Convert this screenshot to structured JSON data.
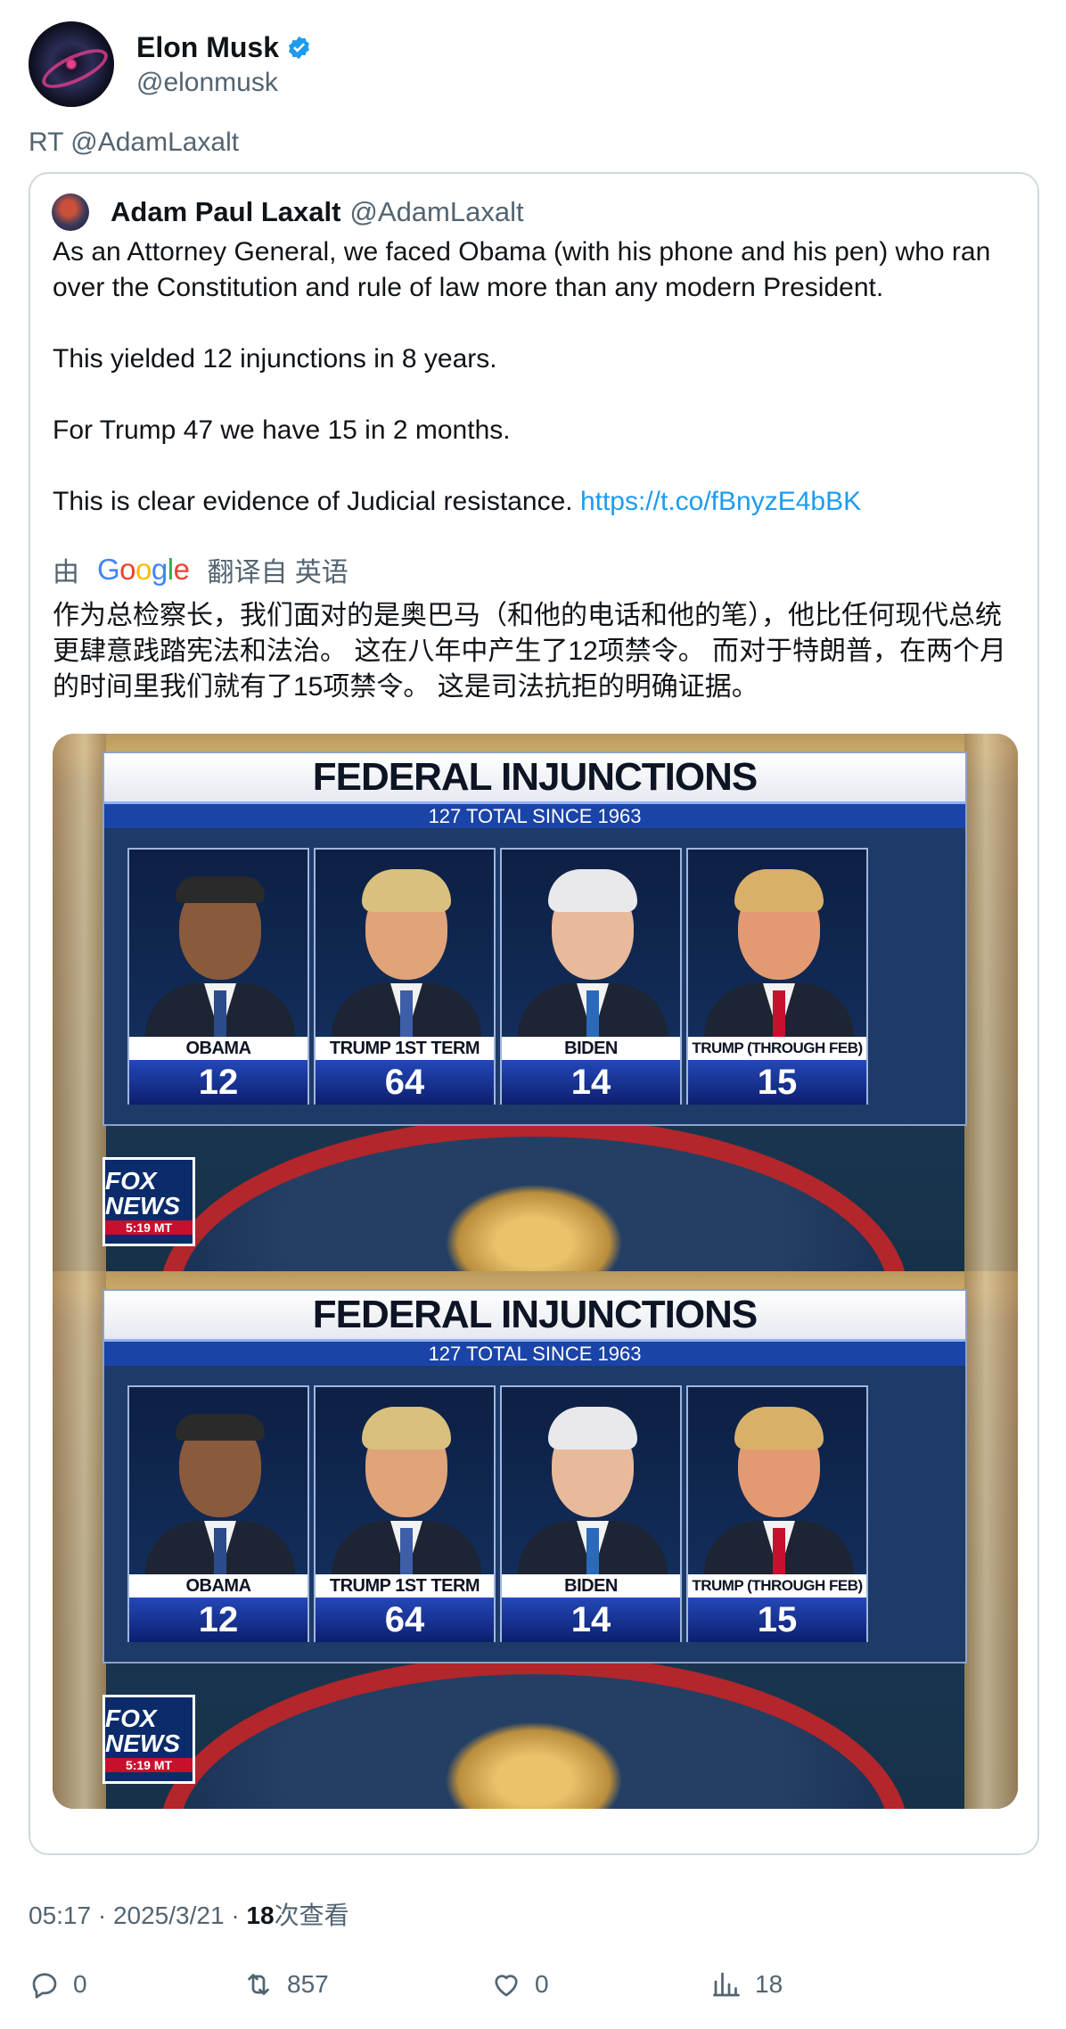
{
  "author": {
    "display_name": "Elon Musk",
    "handle": "@elonmusk",
    "avatar_icon": "avatar-icon",
    "verified_icon": "verified-badge-icon",
    "verified_color": "#1d9bf0"
  },
  "retweet_line": "RT @AdamLaxalt",
  "quoted": {
    "display_name": "Adam Paul Laxalt",
    "handle": "@AdamLaxalt",
    "paragraphs": [
      "As an Attorney General, we faced Obama (with his phone and his pen) who ran over the Constitution and rule of law more than any modern President.",
      "This yielded 12 injunctions in 8 years.",
      "For Trump 47 we have 15 in 2 months.",
      "This is clear evidence of Judicial resistance."
    ],
    "link": "https://t.co/fBnyzE4bBK",
    "translation": {
      "prefix": "由",
      "google_logo_text": "Google",
      "suffix": "翻译自 英语",
      "text": "作为总检察长，我们面对的是奥巴马（和他的电话和他的笔），他比任何现代总统更肆意践踏宪法和法治。 这在八年中产生了12项禁令。 而对于特朗普，在两个月的时间里我们就有了15项禁令。 这是司法抗拒的明确证据。"
    },
    "media": {
      "board_title": "FEDERAL INJUNCTIONS",
      "board_subtitle": "127 TOTAL SINCE 1963",
      "cards": [
        {
          "name": "OBAMA",
          "count": "12"
        },
        {
          "name": "TRUMP 1ST TERM",
          "count": "64"
        },
        {
          "name": "BIDEN",
          "count": "14"
        },
        {
          "name": "TRUMP (THROUGH FEB)",
          "count": "15"
        }
      ],
      "network_logo": "FOX NEWS",
      "network_time": "5:19 MT"
    }
  },
  "meta": {
    "time": "05:17",
    "date": "2025/3/21",
    "views_count": "18",
    "views_label": "次查看"
  },
  "actions": {
    "reply_count": "0",
    "retweet_count": "857",
    "like_count": "0",
    "views_count": "18"
  },
  "colors": {
    "text_primary": "#0f1419",
    "text_secondary": "#536471",
    "link": "#1d9bf0",
    "border": "#cfd9de"
  }
}
